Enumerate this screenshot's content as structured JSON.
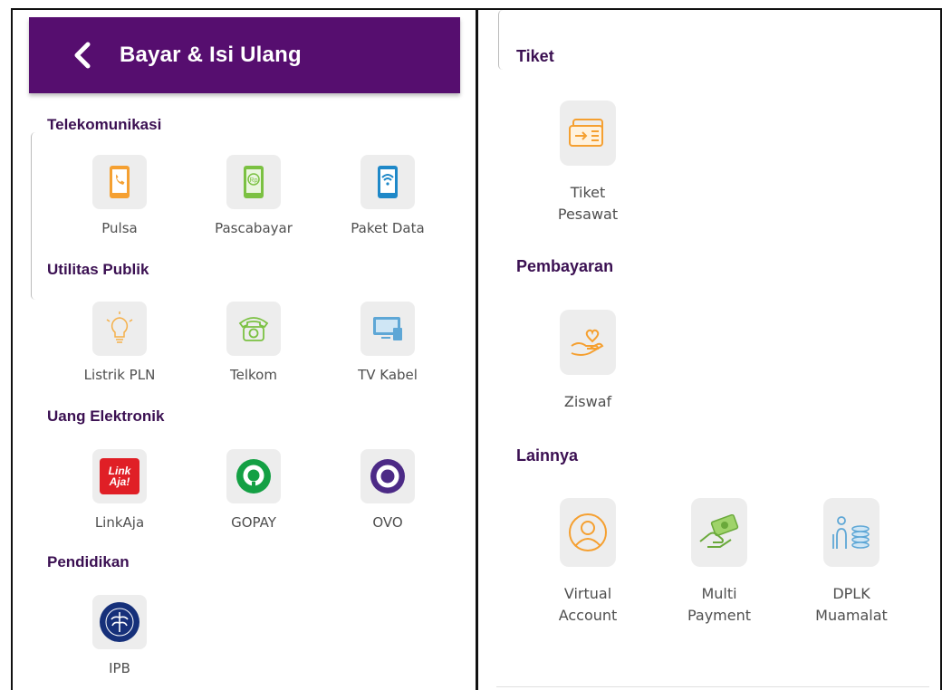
{
  "header": {
    "title": "Bayar & Isi Ulang",
    "back_icon": "chevron-left-icon"
  },
  "colors": {
    "brand": "#560e6f",
    "icon_orange": "#f5a031",
    "icon_green": "#7bc142",
    "icon_blue": "#1e88c8",
    "tile_bg": "#ededed"
  },
  "left_sections": [
    {
      "title": "Telekomunikasi",
      "items": [
        {
          "label": "Pulsa",
          "icon": "phone-icon"
        },
        {
          "label": "Pascabayar",
          "icon": "postpaid-phone-icon"
        },
        {
          "label": "Paket Data",
          "icon": "wifi-phone-icon"
        }
      ]
    },
    {
      "title": "Utilitas Publik",
      "items": [
        {
          "label": "Listrik PLN",
          "icon": "lightbulb-icon"
        },
        {
          "label": "Telkom",
          "icon": "telephone-icon"
        },
        {
          "label": "TV Kabel",
          "icon": "tv-icon"
        }
      ]
    },
    {
      "title": "Uang Elektronik",
      "items": [
        {
          "label": "LinkAja",
          "icon": "linkaja-logo-icon",
          "logo_text_1": "Link",
          "logo_text_2": "Aja!"
        },
        {
          "label": "GOPAY",
          "icon": "gopay-logo-icon"
        },
        {
          "label": "OVO",
          "icon": "ovo-logo-icon"
        }
      ]
    },
    {
      "title": "Pendidikan",
      "items": [
        {
          "label": "IPB",
          "icon": "ipb-seal-icon"
        }
      ]
    }
  ],
  "right_sections": [
    {
      "title": "Tiket",
      "items": [
        {
          "label_1": "Tiket",
          "label_2": "Pesawat",
          "icon": "plane-ticket-icon"
        }
      ]
    },
    {
      "title": "Pembayaran",
      "items": [
        {
          "label_1": "Ziswaf",
          "label_2": "",
          "icon": "charity-hand-icon"
        }
      ]
    },
    {
      "title": "Lainnya",
      "items": [
        {
          "label_1": "Virtual",
          "label_2": "Account",
          "icon": "user-account-icon"
        },
        {
          "label_1": "Multi",
          "label_2": "Payment",
          "icon": "money-hand-icon"
        },
        {
          "label_1": "DPLK",
          "label_2": "Muamalat",
          "icon": "pension-coins-icon"
        }
      ]
    }
  ]
}
